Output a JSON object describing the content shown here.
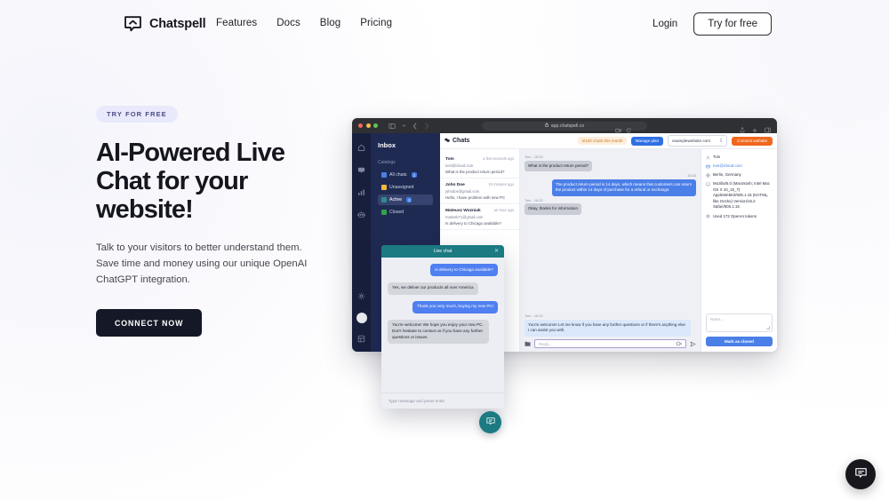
{
  "header": {
    "brand": "Chatspell",
    "logo_icon": "chat-bubble-arrow-icon",
    "nav": [
      {
        "label": "Features"
      },
      {
        "label": "Docs"
      },
      {
        "label": "Blog"
      },
      {
        "label": "Pricing"
      }
    ],
    "login_label": "Login",
    "try_label": "Try for free"
  },
  "hero": {
    "badge": "TRY FOR FREE",
    "title": "AI-Powered Live Chat for your website!",
    "subtitle": "Talk to your visitors to better understand them. Save time and money using our unique OpenAI ChatGPT integration.",
    "cta_label": "CONNECT NOW"
  },
  "browser": {
    "url": "app.chatspell.co",
    "lock_icon": "lock-icon",
    "traffic_lights": [
      "close-red",
      "minimize-yellow",
      "maximize-green"
    ]
  },
  "app": {
    "rail_icons": [
      "home-icon",
      "chat-icon",
      "analytics-icon",
      "robot-icon",
      "settings-icon",
      "user-avatar",
      "apps-grid-icon"
    ],
    "inbox": {
      "title": "Inbox",
      "section_label": "Catalogs",
      "items": [
        {
          "label": "All chats",
          "count": "3",
          "icon": "all-chats-icon",
          "active": false
        },
        {
          "label": "Unassigned",
          "count": "",
          "icon": "unassigned-icon",
          "active": false
        },
        {
          "label": "Active",
          "count": "3",
          "icon": "active-icon",
          "active": true
        },
        {
          "label": "Closed",
          "count": "",
          "icon": "closed-icon",
          "active": false
        }
      ]
    },
    "topbar": {
      "title": "Chats",
      "title_icon": "chats-icon",
      "quota": "3/100 chats this month",
      "manage_plan": "Manage plan",
      "site": "examplewebsite.com",
      "connect": "Connect website"
    },
    "conversations": [
      {
        "name": "Tom",
        "time": "a few seconds ago",
        "email": "tom@icloud.com",
        "preview": "What is the product return period?"
      },
      {
        "name": "John Doe",
        "time": "10 minutes ago",
        "email": "johndoe@gmail.com",
        "preview": "Hello, I have problem with new PC"
      },
      {
        "name": "Mateusz Wozniak",
        "time": "an hour ago",
        "email": "matiosk71@gmail.com",
        "preview": "Is delivery to Chicago available?"
      }
    ],
    "thread": [
      {
        "meta": "Tom - 18:33",
        "side": "in",
        "text": "What is the product return period?"
      },
      {
        "meta": "18:33",
        "side": "out",
        "text": "The product return period is 14 days, which means that customers can return the product within 14 days of purchase for a refund or exchange."
      },
      {
        "meta": "Tom - 18:33",
        "side": "in",
        "text": "Okay, thanks for information"
      },
      {
        "meta": "Tom - 18:33",
        "side": "pale",
        "text": "You're welcome! Let me know if you have any further questions or if there's anything else I can assist you with."
      }
    ],
    "composer": {
      "placeholder": "Reply...",
      "attach_icon": "attachment-icon",
      "emoji_icon": "emoji-icon",
      "send_icon": "send-icon"
    },
    "details": {
      "name": "Tom",
      "name_icon": "user-icon",
      "email": "tom@icloud.com",
      "email_icon": "envelope-icon",
      "location": "Berlin, Germany",
      "location_icon": "globe-icon",
      "user_agent": "Mozilla/5.0 (Macintosh; Intel Mac OS X 10_15_7) AppleWebKit/605.1.15 (KHTML, like Gecko) Version/16.2 Safari/605.1.15",
      "user_agent_icon": "monitor-icon",
      "tokens": "Used 172 OpenAI tokens",
      "tokens_icon": "openai-icon",
      "notes_placeholder": "Notes...",
      "close_label": "Mark as closed"
    }
  },
  "widget": {
    "title": "Live chat",
    "close_icon": "close-icon",
    "messages": [
      {
        "side": "me",
        "text": "Is delivery to Chicago available?"
      },
      {
        "side": "them",
        "text": "Yes, we deliver our products all over America"
      },
      {
        "side": "me",
        "text": "Thank you very much, buying my new PC!"
      },
      {
        "side": "them",
        "text": "You're welcome! We hope you enjoy your new PC. Don't hesitate to contact us if you have any further questions or issues."
      }
    ],
    "input_placeholder": "Type message and press enter",
    "fab_icon": "chat-bubble-icon"
  },
  "page_fab": {
    "icon": "chat-bubble-icon"
  },
  "colors": {
    "ink": "#16161f",
    "dark": "#151826",
    "badge_bg": "#e8e9fa",
    "badge_text": "#4c4d85",
    "widget_teal": "#1b7a82",
    "blue": "#4b7fe8",
    "orange": "#f0681e",
    "inbox_navy": "#1f2a53",
    "rail_navy": "#171f3d"
  }
}
